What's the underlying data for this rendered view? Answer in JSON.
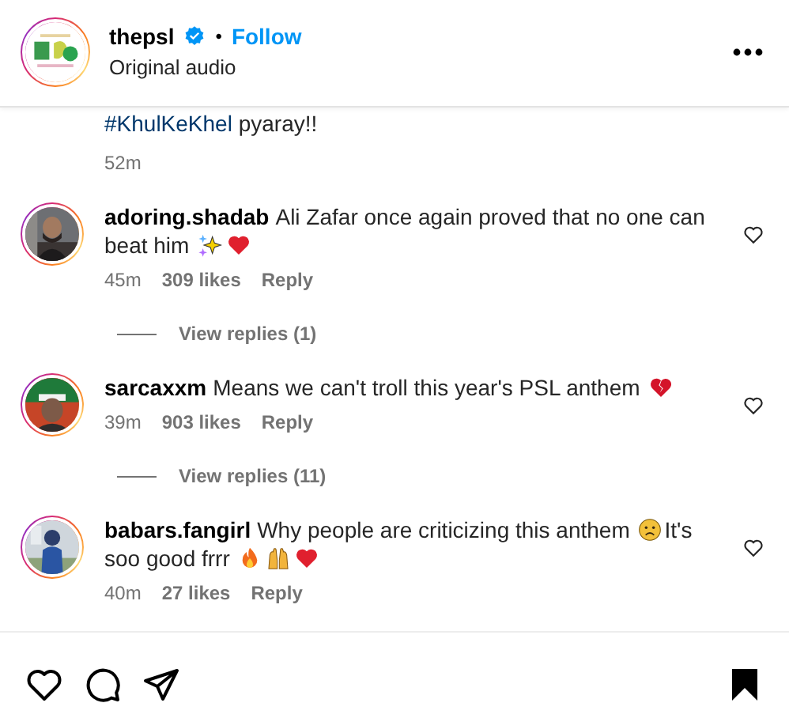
{
  "header": {
    "username": "thepsl",
    "verified": true,
    "separator": "•",
    "follow": "Follow",
    "subtitle": "Original audio"
  },
  "caption": {
    "hashtag": "#KhulKeKhel",
    "text": "pyaray!!",
    "time": "52m"
  },
  "comments": [
    {
      "username": "adoring.shadab",
      "segments": [
        {
          "kind": "text",
          "text": "Ali Zafar once again proved that no one can"
        },
        {
          "kind": "text",
          "text": "beat him"
        },
        {
          "kind": "sparkles"
        },
        {
          "kind": "heart"
        }
      ],
      "time": "45m",
      "likes": "309 likes",
      "reply": "Reply",
      "view_replies": "View replies (1)"
    },
    {
      "username": "sarcaxxm",
      "segments": [
        {
          "kind": "text",
          "text": "Means we can't troll this year's PSL anthem"
        },
        {
          "kind": "broken-heart"
        }
      ],
      "time": "39m",
      "likes": "903 likes",
      "reply": "Reply",
      "view_replies": "View replies (11)"
    },
    {
      "username": "babars.fangirl",
      "segments": [
        {
          "kind": "text",
          "text": "Why people are criticizing this anthem"
        },
        {
          "kind": "frown"
        },
        {
          "kind": "text",
          "text": "It's"
        },
        {
          "kind": "text",
          "text": "soo good frrr"
        },
        {
          "kind": "fire"
        },
        {
          "kind": "raised-hands"
        },
        {
          "kind": "heart"
        }
      ],
      "time": "40m",
      "likes": "27 likes",
      "reply": "Reply"
    }
  ],
  "actions": {
    "saved": true
  }
}
